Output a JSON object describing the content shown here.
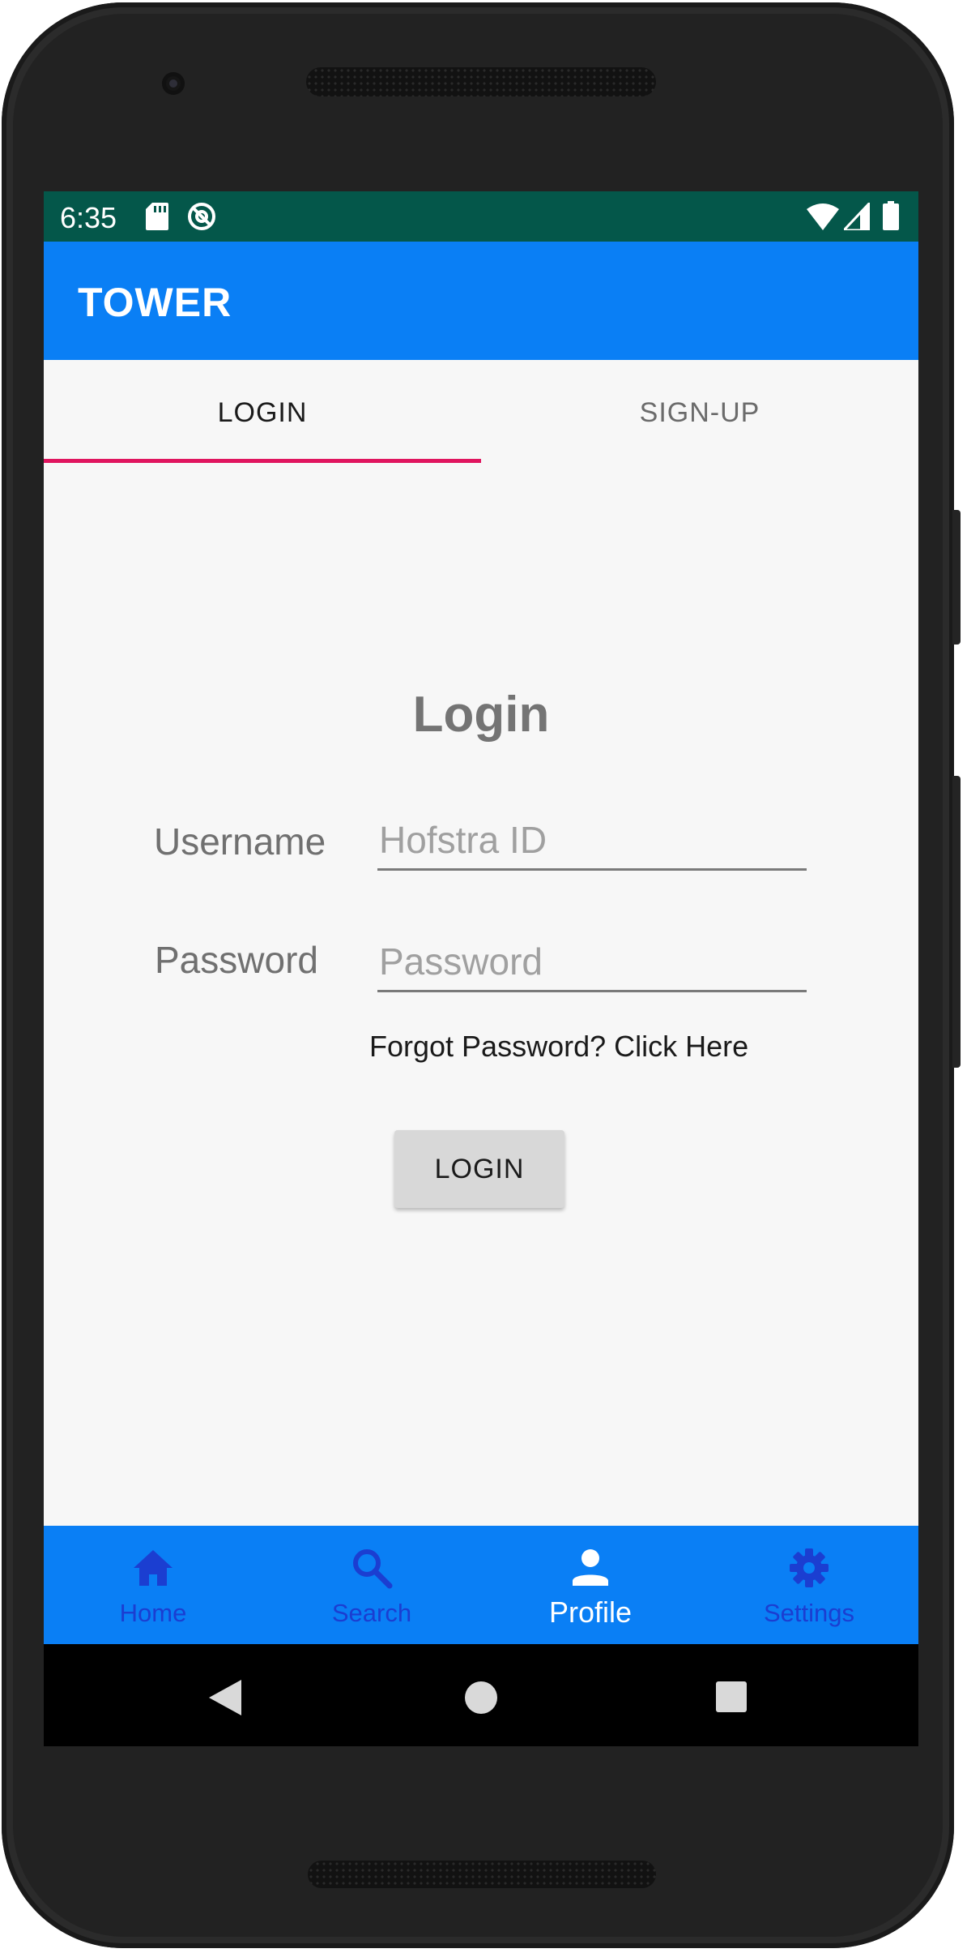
{
  "status_bar": {
    "time": "6:35"
  },
  "app_bar": {
    "title": "TOWER"
  },
  "tabs": [
    {
      "label": "LOGIN",
      "active": true
    },
    {
      "label": "SIGN-UP",
      "active": false
    }
  ],
  "login_form": {
    "title": "Login",
    "username_label": "Username",
    "username_placeholder": "Hofstra ID",
    "username_value": "",
    "password_label": "Password",
    "password_placeholder": "Password",
    "password_value": "",
    "forgot_link": "Forgot Password? Click Here",
    "submit_label": "LOGIN"
  },
  "bottom_nav": {
    "items": [
      {
        "label": "Home",
        "icon": "home-icon",
        "active": false
      },
      {
        "label": "Search",
        "icon": "search-icon",
        "active": false
      },
      {
        "label": "Profile",
        "icon": "person-icon",
        "active": true
      },
      {
        "label": "Settings",
        "icon": "gear-icon",
        "active": false
      }
    ]
  },
  "colors": {
    "status_bar": "#04574a",
    "app_bar": "#0a7ff5",
    "tab_indicator": "#e0155f",
    "nav_inactive": "#1b3ed1",
    "nav_active": "#ffffff"
  }
}
